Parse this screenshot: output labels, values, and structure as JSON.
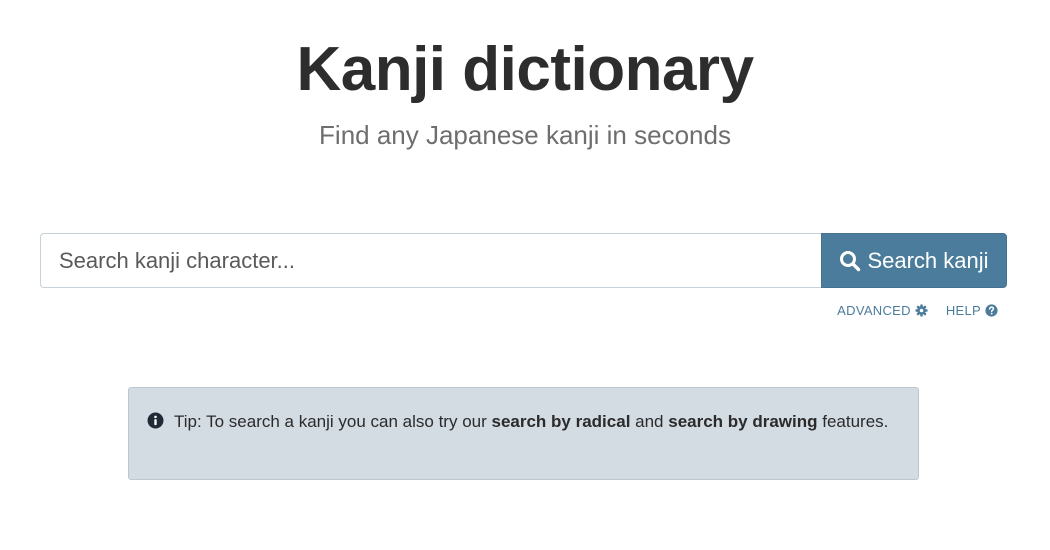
{
  "header": {
    "title": "Kanji dictionary",
    "subtitle": "Find any Japanese kanji in seconds"
  },
  "search": {
    "placeholder": "Search kanji character...",
    "value": "",
    "button_label": "Search kanji",
    "button_icon": "search-icon"
  },
  "links": {
    "advanced_label": "ADVANCED",
    "advanced_icon": "gear-icon",
    "help_label": "HELP",
    "help_icon": "question-circle-icon"
  },
  "tip": {
    "icon": "info-icon",
    "prefix": "Tip: To search a kanji you can also try our ",
    "link1": "search by radical",
    "middle": " and ",
    "link2": "search by drawing",
    "suffix": " features."
  },
  "colors": {
    "accent": "#4b7c9b",
    "tip_background": "#d3dbe3"
  }
}
